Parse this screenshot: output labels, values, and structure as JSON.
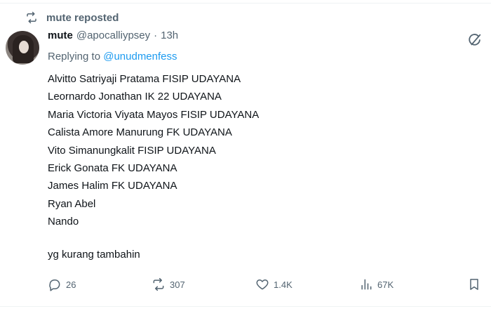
{
  "repost": {
    "icon": "repost-icon",
    "text": "mute reposted"
  },
  "author": {
    "display_name": "mute",
    "handle": "@apocalliypsey",
    "separator": "·",
    "time": "13h",
    "avatar_icon": "avatar"
  },
  "reply": {
    "prefix": "Replying to",
    "to": "@unudmenfess"
  },
  "body": {
    "lines": [
      "Alvitto Satriyaji Pratama FISIP UDAYANA",
      "Leornardo Jonathan IK 22 UDAYANA",
      "Maria Victoria Viyata Mayos FISIP UDAYANA",
      "Calista Amore Manurung FK UDAYANA",
      "Vito Simanungkalit FISIP UDAYANA",
      "Erick Gonata FK UDAYANA",
      "James Halim FK UDAYANA",
      "Ryan Abel",
      "Nando"
    ],
    "closing": "yg kurang tambahin"
  },
  "actions": {
    "replies": "26",
    "reposts": "307",
    "likes": "1.4K",
    "views": "67K"
  },
  "icons": {
    "grok": "grok-icon",
    "reply": "reply-icon",
    "repost": "repost-icon",
    "like": "heart-icon",
    "views": "analytics-icon",
    "bookmark": "bookmark-icon"
  },
  "colors": {
    "text": "#0f1419",
    "secondary": "#536471",
    "link": "#1d9bf0",
    "divider": "#eff3f4"
  }
}
